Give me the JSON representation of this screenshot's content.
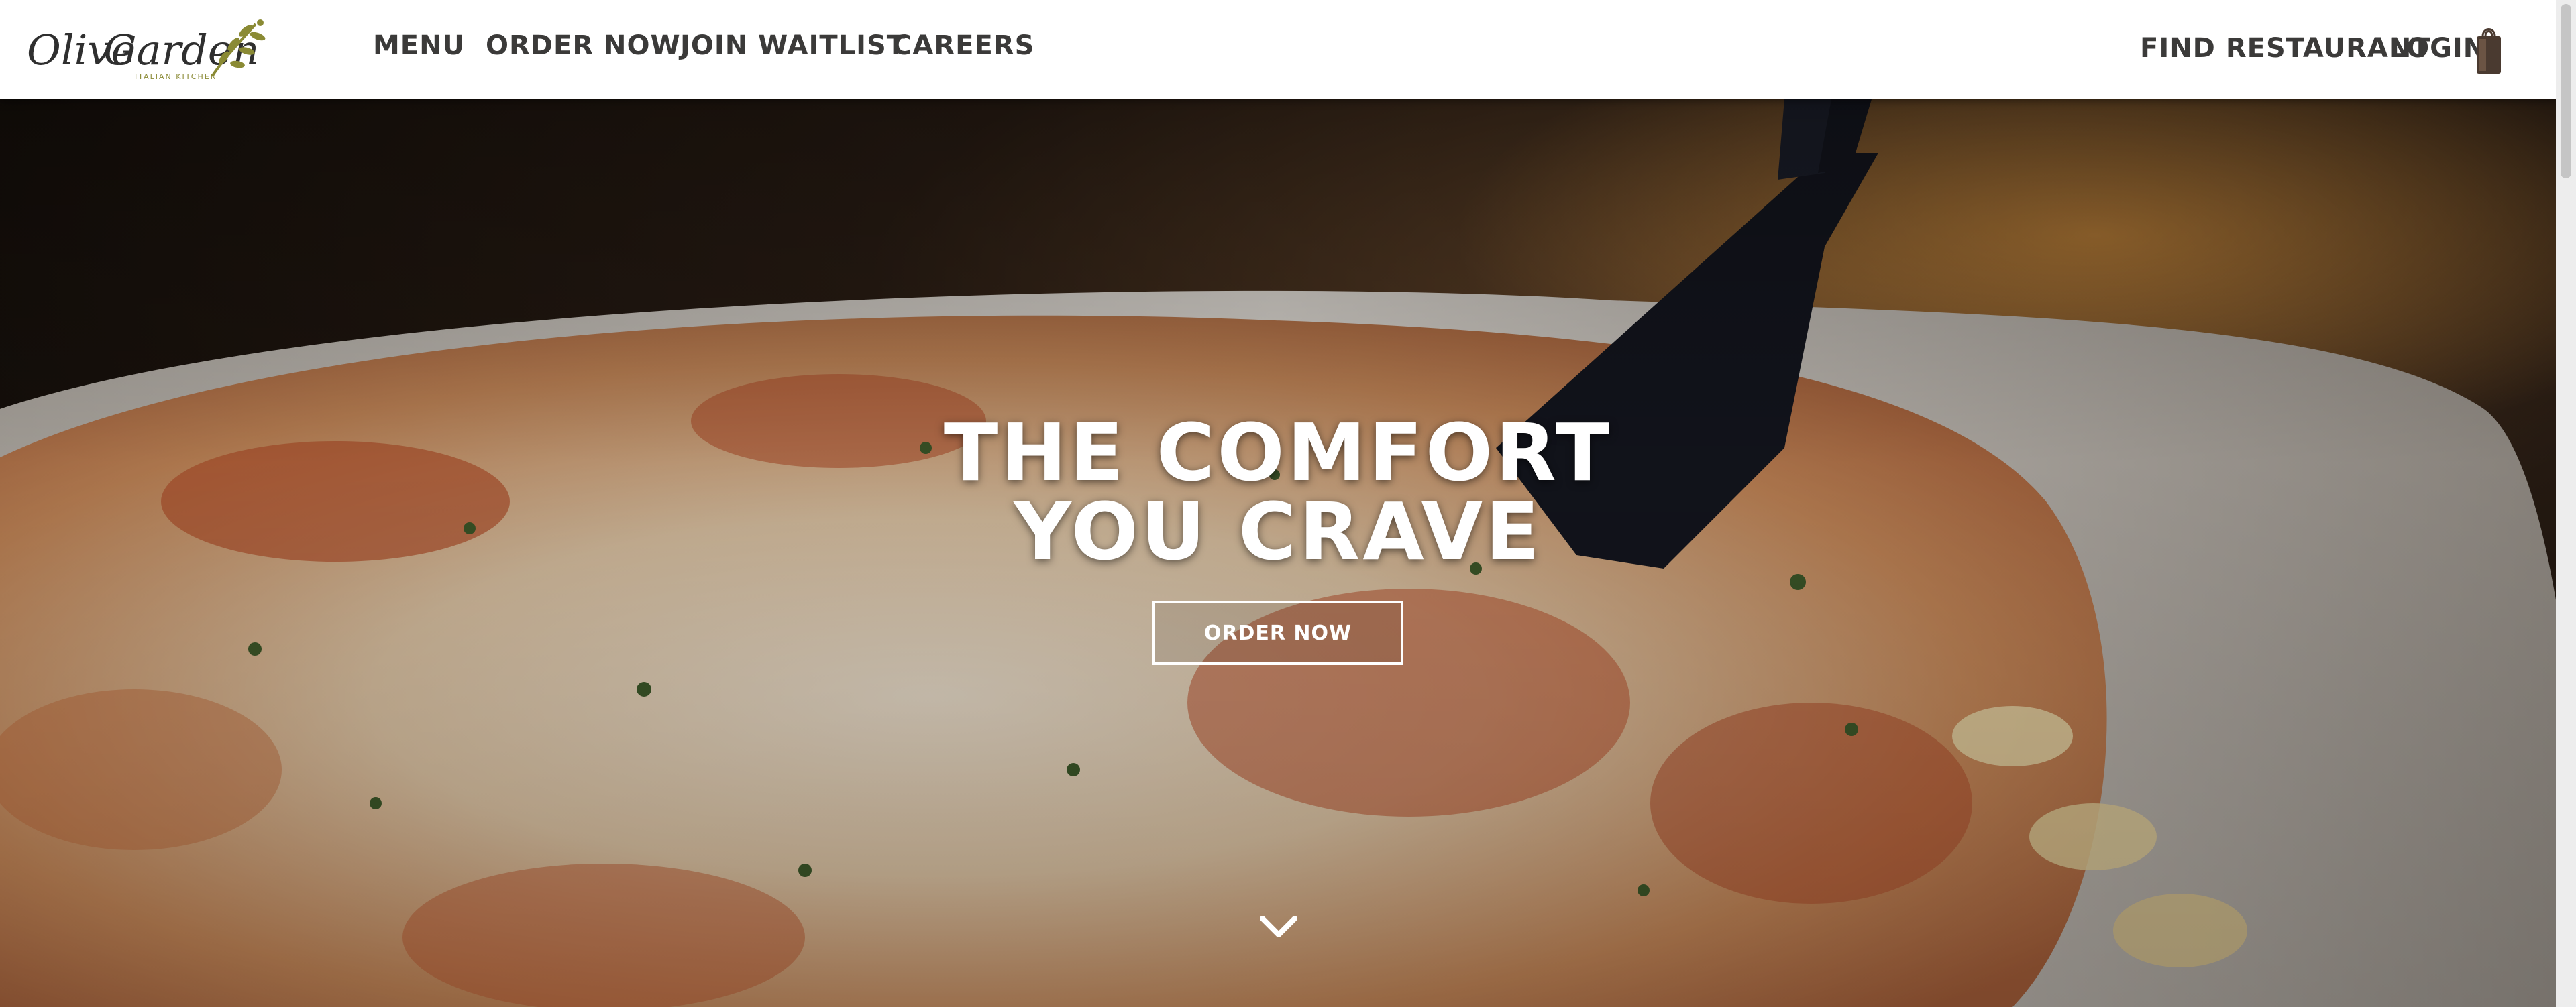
{
  "header": {
    "brand": {
      "name_part1": "Olive",
      "name_part2": "Garden",
      "tagline": "ITALIAN KITCHEN",
      "logo_icon": "olive-branch-icon"
    },
    "nav": [
      {
        "label": "MENU"
      },
      {
        "label": "ORDER NOW"
      },
      {
        "label": "JOIN WAITLIST"
      },
      {
        "label": "CAREERS"
      }
    ],
    "utility": {
      "find_restaurant": "FIND RESTAURANT",
      "login": "LOGIN",
      "bag_icon": "shopping-bag-icon"
    }
  },
  "hero": {
    "title_line1": "THE COMFORT",
    "title_line2": "YOU CRAVE",
    "cta_label": "ORDER NOW",
    "scroll_icon": "chevron-down-icon"
  },
  "colors": {
    "nav_text": "#3b3a39",
    "header_bg": "#ffffff",
    "brand_olive": "#8a8a34",
    "hero_text": "#ffffff"
  }
}
